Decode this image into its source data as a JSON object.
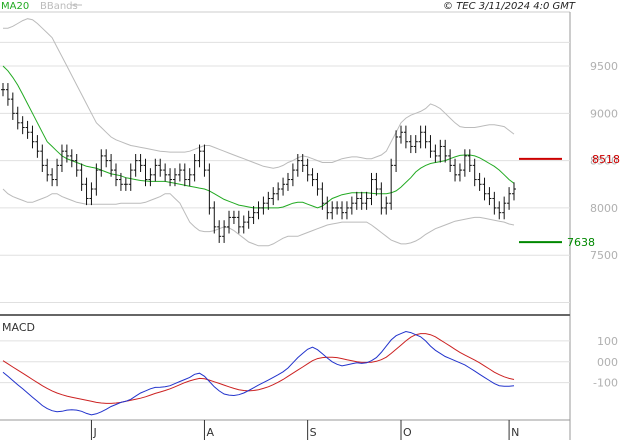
{
  "header": {
    "indicator_ma": "MA20",
    "indicator_bb": "BBands",
    "copyright": "© TEC 3/11/2024 4:0 GMT"
  },
  "panels": {
    "macd_label": "MACD"
  },
  "colors": {
    "ma20": "#22aa22",
    "bbands": "#bbbbbb",
    "price": "#111111",
    "macd": "#2233cc",
    "signal": "#cc2222",
    "resistance": "#cc0000",
    "support": "#008800",
    "grid": "#e0e0e0"
  },
  "levels": {
    "resistance": {
      "value": 8518,
      "label": "8518"
    },
    "support": {
      "value": 7638,
      "label": "7638"
    }
  },
  "chart_data": [
    {
      "type": "ohlc",
      "title": "",
      "legend": [
        "MA20",
        "BBands"
      ],
      "y_ticks": [
        "9500",
        "9000",
        "8500",
        "8000",
        "7500"
      ],
      "y_tick_values": [
        9500,
        9000,
        8500,
        8000,
        7500
      ],
      "ylim": [
        6900,
        10050
      ],
      "x_ticks": [
        "J",
        "A",
        "S",
        "O",
        "N"
      ],
      "x_tick_index": [
        18,
        41,
        62,
        81,
        103
      ],
      "grid": true,
      "close": [
        9250,
        9150,
        9000,
        8900,
        8850,
        8800,
        8700,
        8600,
        8450,
        8350,
        8300,
        8450,
        8600,
        8550,
        8500,
        8400,
        8250,
        8100,
        8200,
        8400,
        8550,
        8500,
        8400,
        8300,
        8250,
        8250,
        8400,
        8500,
        8450,
        8300,
        8350,
        8450,
        8400,
        8350,
        8300,
        8350,
        8400,
        8300,
        8350,
        8500,
        8600,
        8400,
        8000,
        7800,
        7700,
        7800,
        7900,
        7900,
        7800,
        7850,
        7900,
        7950,
        8000,
        8050,
        8100,
        8150,
        8200,
        8250,
        8300,
        8400,
        8500,
        8450,
        8350,
        8300,
        8200,
        8050,
        7950,
        8000,
        8000,
        7950,
        8000,
        8050,
        8100,
        8050,
        8100,
        8300,
        8200,
        8000,
        8050,
        8450,
        8750,
        8800,
        8700,
        8650,
        8700,
        8800,
        8700,
        8600,
        8550,
        8650,
        8550,
        8450,
        8350,
        8400,
        8550,
        8450,
        8300,
        8250,
        8150,
        8100,
        8000,
        7950,
        8050,
        8150,
        8200
      ],
      "ma20": [
        9500,
        9450,
        9380,
        9300,
        9200,
        9100,
        9000,
        8900,
        8800,
        8700,
        8650,
        8600,
        8550,
        8520,
        8500,
        8480,
        8460,
        8440,
        8430,
        8420,
        8400,
        8380,
        8360,
        8350,
        8340,
        8320,
        8310,
        8300,
        8290,
        8285,
        8280,
        8280,
        8280,
        8280,
        8270,
        8260,
        8250,
        8240,
        8230,
        8220,
        8210,
        8200,
        8180,
        8150,
        8120,
        8090,
        8070,
        8050,
        8030,
        8020,
        8010,
        8000,
        8000,
        8000,
        8000,
        8000,
        8000,
        8010,
        8030,
        8050,
        8060,
        8060,
        8040,
        8020,
        8000,
        8020,
        8060,
        8100,
        8120,
        8140,
        8150,
        8160,
        8160,
        8160,
        8160,
        8155,
        8150,
        8150,
        8150,
        8160,
        8180,
        8220,
        8270,
        8320,
        8380,
        8420,
        8450,
        8470,
        8480,
        8490,
        8500,
        8520,
        8540,
        8555,
        8560,
        8560,
        8550,
        8530,
        8500,
        8470,
        8440,
        8400,
        8350,
        8300,
        8260
      ],
      "bb_upper": [
        9900,
        9900,
        9920,
        9950,
        9980,
        10000,
        9990,
        9950,
        9900,
        9850,
        9800,
        9700,
        9600,
        9500,
        9400,
        9300,
        9200,
        9100,
        9000,
        8900,
        8850,
        8800,
        8750,
        8720,
        8700,
        8680,
        8660,
        8650,
        8640,
        8630,
        8620,
        8610,
        8600,
        8595,
        8590,
        8590,
        8590,
        8590,
        8600,
        8620,
        8640,
        8660,
        8660,
        8640,
        8620,
        8600,
        8580,
        8560,
        8540,
        8520,
        8500,
        8480,
        8460,
        8440,
        8430,
        8420,
        8430,
        8450,
        8480,
        8500,
        8530,
        8550,
        8540,
        8520,
        8500,
        8480,
        8480,
        8480,
        8500,
        8520,
        8530,
        8540,
        8540,
        8530,
        8520,
        8520,
        8540,
        8560,
        8600,
        8700,
        8800,
        8900,
        8950,
        8980,
        9000,
        9020,
        9050,
        9100,
        9080,
        9050,
        9000,
        8950,
        8900,
        8860,
        8850,
        8850,
        8850,
        8860,
        8870,
        8880,
        8880,
        8870,
        8860,
        8820,
        8780
      ],
      "bb_lower": [
        8200,
        8150,
        8120,
        8100,
        8080,
        8060,
        8060,
        8080,
        8100,
        8120,
        8150,
        8150,
        8120,
        8100,
        8080,
        8060,
        8050,
        8040,
        8040,
        8040,
        8040,
        8040,
        8040,
        8040,
        8050,
        8050,
        8050,
        8050,
        8050,
        8060,
        8080,
        8100,
        8120,
        8150,
        8150,
        8100,
        8050,
        7950,
        7850,
        7800,
        7760,
        7750,
        7750,
        7760,
        7780,
        7800,
        7790,
        7760,
        7720,
        7680,
        7640,
        7620,
        7600,
        7600,
        7600,
        7620,
        7650,
        7680,
        7700,
        7700,
        7700,
        7720,
        7740,
        7760,
        7780,
        7800,
        7820,
        7830,
        7840,
        7850,
        7850,
        7850,
        7850,
        7850,
        7850,
        7820,
        7780,
        7740,
        7700,
        7660,
        7640,
        7620,
        7620,
        7630,
        7650,
        7680,
        7720,
        7750,
        7780,
        7800,
        7820,
        7840,
        7860,
        7870,
        7880,
        7890,
        7900,
        7900,
        7890,
        7880,
        7870,
        7860,
        7850,
        7830,
        7820
      ]
    },
    {
      "type": "line",
      "title": "MACD",
      "y_ticks": [
        "100",
        "000",
        "-100"
      ],
      "y_tick_values": [
        100,
        0,
        -100
      ],
      "ylim": [
        -270,
        210
      ],
      "grid": true,
      "series": [
        {
          "name": "",
          "values": [
            -50,
            -70,
            -90,
            -110,
            -130,
            -150,
            -170,
            -190,
            -210,
            -225,
            -235,
            -240,
            -238,
            -232,
            -230,
            -232,
            -238,
            -248,
            -255,
            -250,
            -240,
            -228,
            -215,
            -205,
            -195,
            -190,
            -180,
            -165,
            -150,
            -140,
            -130,
            -123,
            -122,
            -120,
            -115,
            -105,
            -95,
            -85,
            -75,
            -60,
            -55,
            -70,
            -95,
            -120,
            -140,
            -155,
            -160,
            -162,
            -158,
            -150,
            -138,
            -125,
            -112,
            -100,
            -88,
            -75,
            -62,
            -48,
            -30,
            -5,
            20,
            40,
            60,
            70,
            58,
            38,
            18,
            0,
            -12,
            -20,
            -15,
            -10,
            -5,
            -8,
            -5,
            5,
            20,
            45,
            75,
            105,
            125,
            135,
            145,
            140,
            130,
            120,
            100,
            75,
            55,
            40,
            25,
            15,
            5,
            -5,
            -15,
            -30,
            -45,
            -60,
            -75,
            -90,
            -105,
            -115,
            -118,
            -118,
            -115
          ]
        },
        {
          "name": "",
          "values": [
            5,
            -10,
            -25,
            -40,
            -55,
            -70,
            -85,
            -100,
            -115,
            -128,
            -140,
            -150,
            -158,
            -165,
            -170,
            -175,
            -180,
            -185,
            -190,
            -195,
            -198,
            -200,
            -200,
            -198,
            -195,
            -190,
            -185,
            -180,
            -175,
            -168,
            -160,
            -152,
            -145,
            -138,
            -130,
            -120,
            -110,
            -100,
            -92,
            -85,
            -80,
            -82,
            -88,
            -96,
            -104,
            -112,
            -120,
            -128,
            -134,
            -138,
            -140,
            -138,
            -134,
            -128,
            -120,
            -110,
            -98,
            -85,
            -70,
            -55,
            -40,
            -25,
            -10,
            5,
            15,
            20,
            22,
            22,
            20,
            15,
            10,
            5,
            0,
            -3,
            -3,
            -2,
            2,
            10,
            22,
            40,
            60,
            80,
            100,
            118,
            130,
            135,
            135,
            130,
            120,
            105,
            90,
            75,
            60,
            45,
            32,
            20,
            8,
            -5,
            -20,
            -35,
            -50,
            -62,
            -72,
            -80,
            -85
          ]
        }
      ]
    }
  ]
}
